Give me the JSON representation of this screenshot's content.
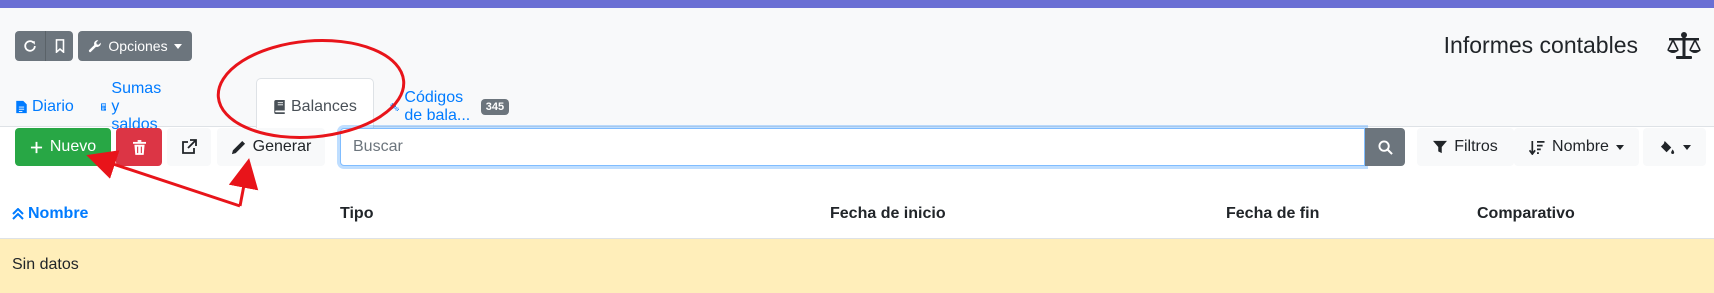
{
  "header": {
    "title": "Informes contables",
    "title_icon": "balance-scale-icon",
    "opciones_label": "Opciones"
  },
  "tabs": [
    {
      "label": "Diario",
      "icon": "file-icon"
    },
    {
      "label": "Sumas y saldos",
      "icon": "calculator-icon"
    },
    {
      "label": "Balances",
      "icon": "book-icon",
      "active": true
    },
    {
      "label": "Códigos de bala...",
      "icon": "cogs-icon",
      "badge": "345"
    }
  ],
  "toolbar": {
    "new_label": "Nuevo",
    "generate_label": "Generar",
    "search_placeholder": "Buscar",
    "filters_label": "Filtros",
    "sort_label": "Nombre"
  },
  "table": {
    "columns": [
      "Nombre",
      "Tipo",
      "Fecha de inicio",
      "Fecha de fin",
      "Comparativo"
    ],
    "sorted_column": "Nombre",
    "empty_text": "Sin datos"
  },
  "colors": {
    "primary": "#007bff",
    "success": "#28a745",
    "danger": "#dc3545",
    "secondary": "#6c757d",
    "empty_row": "#ffeeba",
    "annotation": "#e8141a"
  }
}
